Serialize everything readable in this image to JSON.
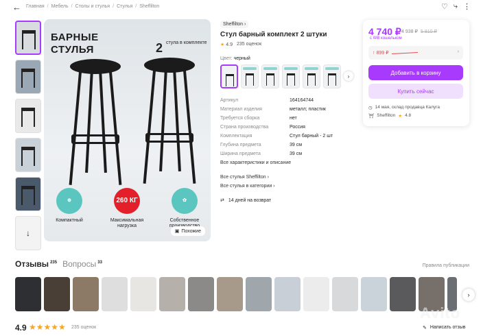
{
  "breadcrumbs": [
    "Главная",
    "Мебель",
    "Столы и стулья",
    "Стулья",
    "Sheffilton"
  ],
  "icons": {
    "back": "arrow-left-icon",
    "favorite": "heart-icon",
    "share": "share-icon",
    "more": "more-icon"
  },
  "hero": {
    "title": "БАРНЫЕ СТУЛЬЯ",
    "count": "2",
    "count_text": "стула в комплекте",
    "features": [
      {
        "label": "Компактный",
        "badge": ""
      },
      {
        "label": "Максимальная нагрузка",
        "badge": "260 КГ"
      },
      {
        "label": "Собственное производство",
        "badge": ""
      }
    ],
    "similar_label": "Похожие"
  },
  "product": {
    "brand": "Sheffilton",
    "title": "Стул барный комплект 2 штуки",
    "rating": "4.9",
    "reviews": "235 оценок",
    "color_label": "Цвет:",
    "color_value": "черный",
    "specs": [
      {
        "k": "Артикул",
        "v": "164164744"
      },
      {
        "k": "Материал изделия",
        "v": "металл; пластик"
      },
      {
        "k": "Требуется сборка",
        "v": "нет"
      },
      {
        "k": "Страна производства",
        "v": "Россия"
      },
      {
        "k": "Комплектация",
        "v": "Стул барный - 2 шт"
      },
      {
        "k": "Глубина предмета",
        "v": "39 см"
      },
      {
        "k": "Ширина предмета",
        "v": "39 см"
      }
    ],
    "all_specs": "Все характеристики и описание",
    "link_brand": "Все стулья Sheffilton",
    "link_category": "Все стулья в категории",
    "returns": "14 дней на возврат"
  },
  "buy": {
    "price": "4 740 ₽",
    "old_price": "4 938 ₽",
    "old_price2": "5 810 ₽",
    "wallet": "с WB кошельком",
    "history_price": "↑ 899 ₽",
    "add_to_cart": "Добавить в корзину",
    "buy_now": "Купить сейчас",
    "delivery": "14 мая, склад продавца Калуга",
    "seller": "Sheffilton",
    "seller_rating": "4.8"
  },
  "reviews": {
    "tab_reviews": "Отзывы",
    "tab_reviews_count": "235",
    "tab_questions": "Вопросы",
    "tab_questions_count": "33",
    "rules": "Правила публикации",
    "score": "4.9",
    "stars": "★★★★★",
    "count": "235 оценок",
    "write": "Написать отзыв"
  },
  "watermark": "Avito",
  "colors": {
    "accent": "#a73afd",
    "accent_light": "#f1dffe",
    "star": "#f5a623",
    "price_history": "#e8474c"
  }
}
